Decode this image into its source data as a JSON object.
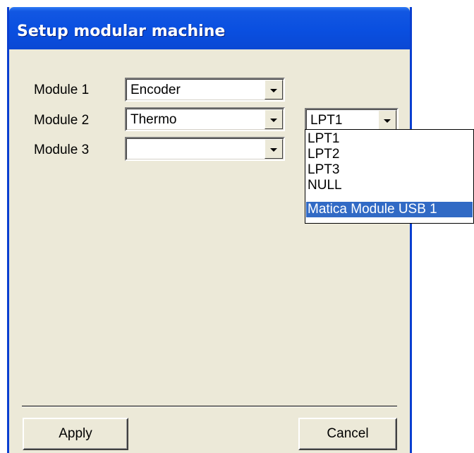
{
  "window": {
    "title": "Setup modular machine"
  },
  "modules": [
    {
      "label": "Module 1",
      "value": "Encoder"
    },
    {
      "label": "Module 2",
      "value": "Thermo"
    },
    {
      "label": "Module 3",
      "value": ""
    }
  ],
  "port": {
    "value": "LPT1",
    "options": [
      "LPT1",
      "LPT2",
      "LPT3",
      "NULL",
      "Matica Module USB 1"
    ],
    "highlighted": "Matica Module USB 1"
  },
  "buttons": {
    "apply_label": "Apply",
    "cancel_label": "Cancel"
  },
  "colors": {
    "title_bar": "#0a4fe0",
    "dialog_bg": "#ece9d8",
    "selection": "#316ac5"
  }
}
